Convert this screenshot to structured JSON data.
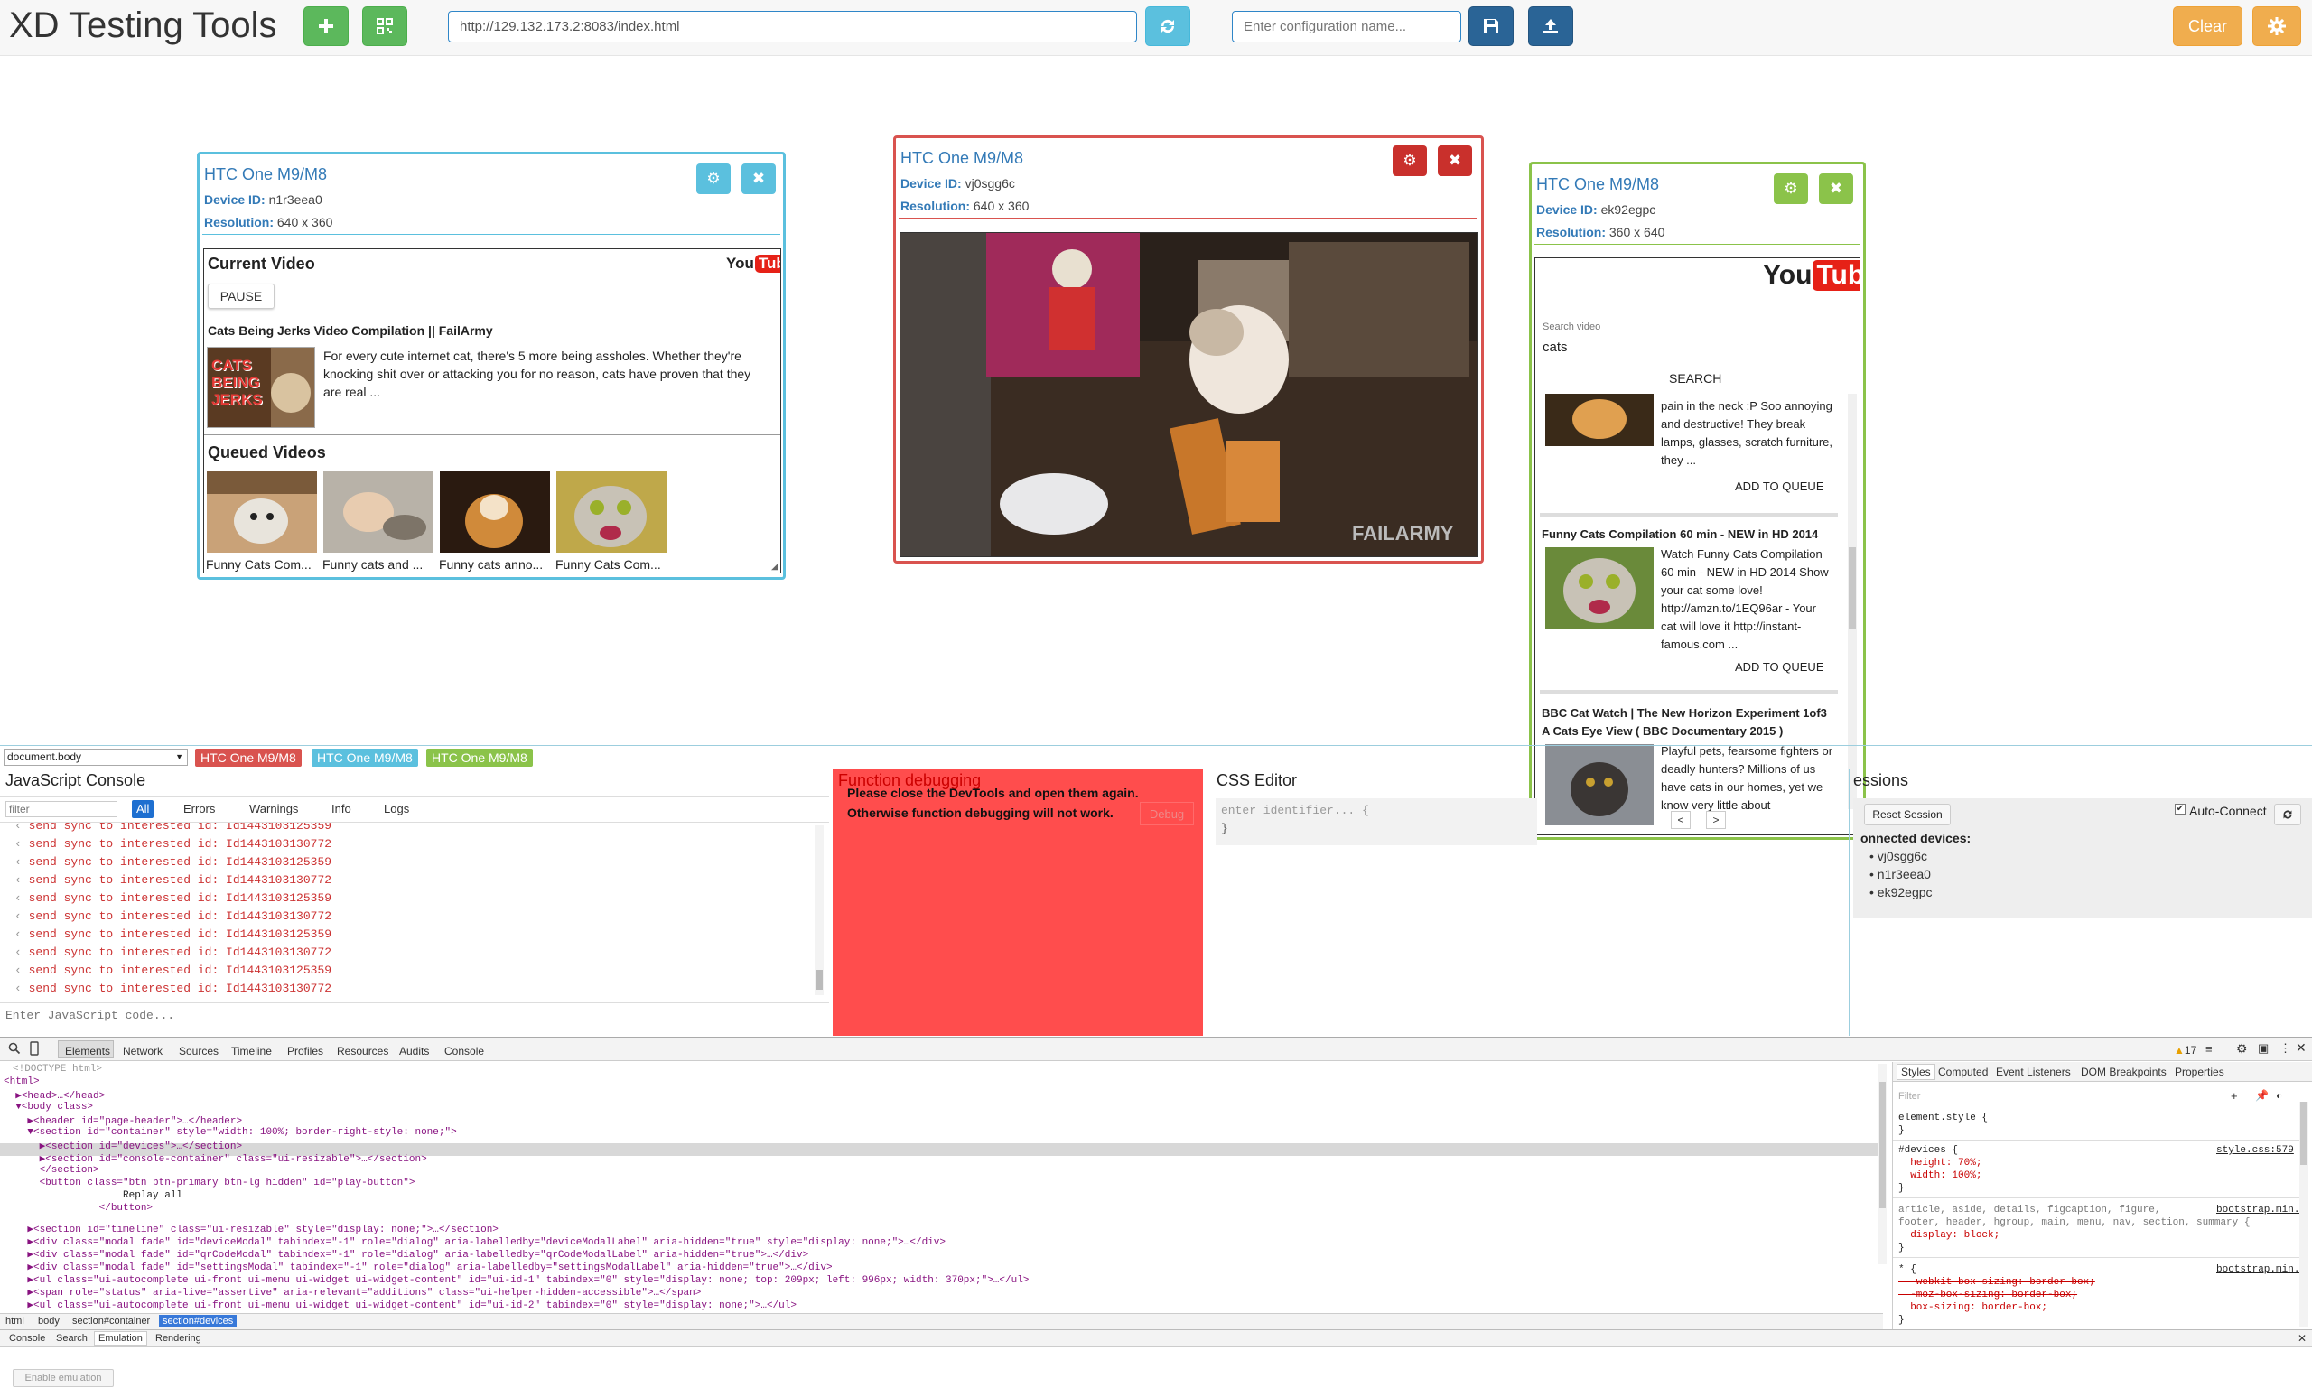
{
  "header": {
    "title": "XD Testing Tools",
    "url_value": "http://129.132.173.2:8083/index.html",
    "config_placeholder": "Enter configuration name...",
    "clear_label": "Clear",
    "icons": {
      "add": "plus-icon",
      "qr": "qr-code-icon",
      "refresh": "refresh-icon",
      "save": "floppy-disk-icon",
      "upload": "upload-icon",
      "settings": "gear-icon"
    }
  },
  "devices": [
    {
      "name": "HTC One M9/M8",
      "id_label": "Device ID:",
      "id_value": "n1r3eea0",
      "res_label": "Resolution:",
      "res_value": "640 x 360",
      "color": "#5bc0de",
      "current_video": {
        "heading": "Current Video",
        "pause_label": "PAUSE",
        "video_title": "Cats Being Jerks Video Compilation || FailArmy",
        "description": "For every cute internet cat, there's 5 more being assholes. Whether they're knocking shit over or attacking you for no reason, cats have proven that they are real ...",
        "thumb_text": "CATS BEING JERKS"
      },
      "queued_heading": "Queued Videos",
      "queued": [
        "Funny Cats Com...",
        "Funny cats and ...",
        "Funny cats anno...",
        "Funny Cats Com..."
      ]
    },
    {
      "name": "HTC One M9/M8",
      "id_label": "Device ID:",
      "id_value": "vj0sgg6c",
      "res_label": "Resolution:",
      "res_value": "640 x 360",
      "color": "#d9534f",
      "watermark": "FAILARMY"
    },
    {
      "name": "HTC One M9/M8",
      "id_label": "Device ID:",
      "id_value": "ek92egpc",
      "res_label": "Resolution:",
      "res_value": "360 x 640",
      "color": "#8bc34a",
      "search_label": "Search video",
      "search_value": "cats",
      "search_button": "SEARCH",
      "results": [
        {
          "title": "",
          "text": "pain in the neck :P Soo annoying and destructive! They break lamps, glasses, scratch furniture, they ...",
          "button": "ADD TO QUEUE"
        },
        {
          "title": "Funny Cats Compilation 60 min - NEW in HD 2014",
          "text": "Watch Funny Cats Compilation 60 min - NEW in HD 2014 Show your cat some love! http://amzn.to/1EQ96ar - Your cat will love it http://instant-famous.com ...",
          "button": "ADD TO QUEUE"
        },
        {
          "title": "BBC Cat Watch | The New Horizon Experiment 1of3 A Cats Eye View ( BBC Documentary 2015 )",
          "text": "Playful pets, fearsome fighters or deadly hunters? Millions of us have cats in our homes, yet we know very little about",
          "button": ""
        }
      ],
      "pager": [
        "<",
        ">"
      ]
    }
  ],
  "bottom": {
    "select_value": "document.body",
    "device_tags": [
      "HTC One M9/M8",
      "HTC One M9/M8",
      "HTC One M9/M8"
    ],
    "console": {
      "title": "JavaScript Console",
      "filter_placeholder": "filter",
      "levels": [
        "All",
        "Errors",
        "Warnings",
        "Info",
        "Logs"
      ],
      "logs": [
        "send sync to interested id: Id1443103125359",
        "send sync to interested id: Id1443103130772",
        "send sync to interested id: Id1443103125359",
        "send sync to interested id: Id1443103130772",
        "send sync to interested id: Id1443103125359",
        "send sync to interested id: Id1443103130772",
        "send sync to interested id: Id1443103125359",
        "send sync to interested id: Id1443103130772",
        "send sync to interested id: Id1443103125359",
        "send sync to interested id: Id1443103130772"
      ],
      "input_placeholder": "Enter JavaScript code..."
    },
    "function_debugging": {
      "title": "Function debugging",
      "message": "Please close the DevTools and open them again. Otherwise function debugging will not work.",
      "debug_label": "Debug"
    },
    "css_editor": {
      "title": "CSS Editor",
      "identifier_placeholder": "enter identifier... {",
      "close_brace": "}"
    },
    "sessions": {
      "title": "essions",
      "reset_label": "Reset Session",
      "auto_connect_label": "Auto-Connect",
      "connected_heading": "onnected devices:",
      "connected": [
        "vj0sgg6c",
        "n1r3eea0",
        "ek92egpc"
      ]
    }
  },
  "devtools": {
    "tabs": [
      "Elements",
      "Network",
      "Sources",
      "Timeline",
      "Profiles",
      "Resources",
      "Audits",
      "Console"
    ],
    "warning_count": "17",
    "dom_lines": [
      "<!DOCTYPE html>",
      "<html>",
      "  ▶<head>…</head>",
      "  ▼<body class>",
      "    ▶<header id=\"page-header\">…</header>",
      "    ▼<section id=\"container\" style=\"width: 100%; border-right-style: none;\">",
      "      ▶<section id=\"devices\">…</section>",
      "      ▶<section id=\"console-container\" class=\"ui-resizable\">…</section>",
      "      </section>",
      "      <button class=\"btn btn-primary btn-lg hidden\" id=\"play-button\">",
      "                    Replay all",
      "                </button>",
      "    ▶<section id=\"timeline\" class=\"ui-resizable\" style=\"display: none;\">…</section>",
      "    ▶<div class=\"modal fade\" id=\"deviceModal\" tabindex=\"-1\" role=\"dialog\" aria-labelledby=\"deviceModalLabel\" aria-hidden=\"true\" style=\"display: none;\">…</div>",
      "    ▶<div class=\"modal fade\" id=\"qrCodeModal\" tabindex=\"-1\" role=\"dialog\" aria-labelledby=\"qrCodeModalLabel\" aria-hidden=\"true\">…</div>",
      "    ▶<div class=\"modal fade\" id=\"settingsModal\" tabindex=\"-1\" role=\"dialog\" aria-labelledby=\"settingsModalLabel\" aria-hidden=\"true\">…</div>",
      "    ▶<ul class=\"ui-autocomplete ui-front ui-menu ui-widget ui-widget-content\" id=\"ui-id-1\" tabindex=\"0\" style=\"display: none; top: 209px; left: 996px; width: 370px;\">…</ul>",
      "    ▶<span role=\"status\" aria-live=\"assertive\" aria-relevant=\"additions\" class=\"ui-helper-hidden-accessible\">…</span>",
      "    ▶<ul class=\"ui-autocomplete ui-front ui-menu ui-widget ui-widget-content\" id=\"ui-id-2\" tabindex=\"0\" style=\"display: none;\">…</ul>"
    ],
    "breadcrumbs": [
      "html",
      "body",
      "section#container",
      "section#devices"
    ],
    "style_tabs": [
      "Styles",
      "Computed",
      "Event Listeners",
      "DOM Breakpoints",
      "Properties"
    ],
    "style_filter": "Filter",
    "style_lines": [
      "element.style {",
      "}",
      "#devices {",
      "  height: 70%;",
      "  width: 100%;",
      "}",
      "article, aside, details, figcaption, figure,",
      "footer, header, hgroup, main, menu, nav, section, summary {",
      "  display: block;",
      "}",
      "* {",
      "  -webkit-box-sizing: border-box;",
      "  -moz-box-sizing: border-box;",
      "  box-sizing: border-box;",
      "}"
    ],
    "style_sources": [
      "style.css:579",
      "bootstrap.min.css:5",
      "bootstrap.min.css:5"
    ],
    "drawer_tabs": [
      "Console",
      "Search",
      "Emulation",
      "Rendering"
    ],
    "enable_emulation": "Enable emulation"
  }
}
